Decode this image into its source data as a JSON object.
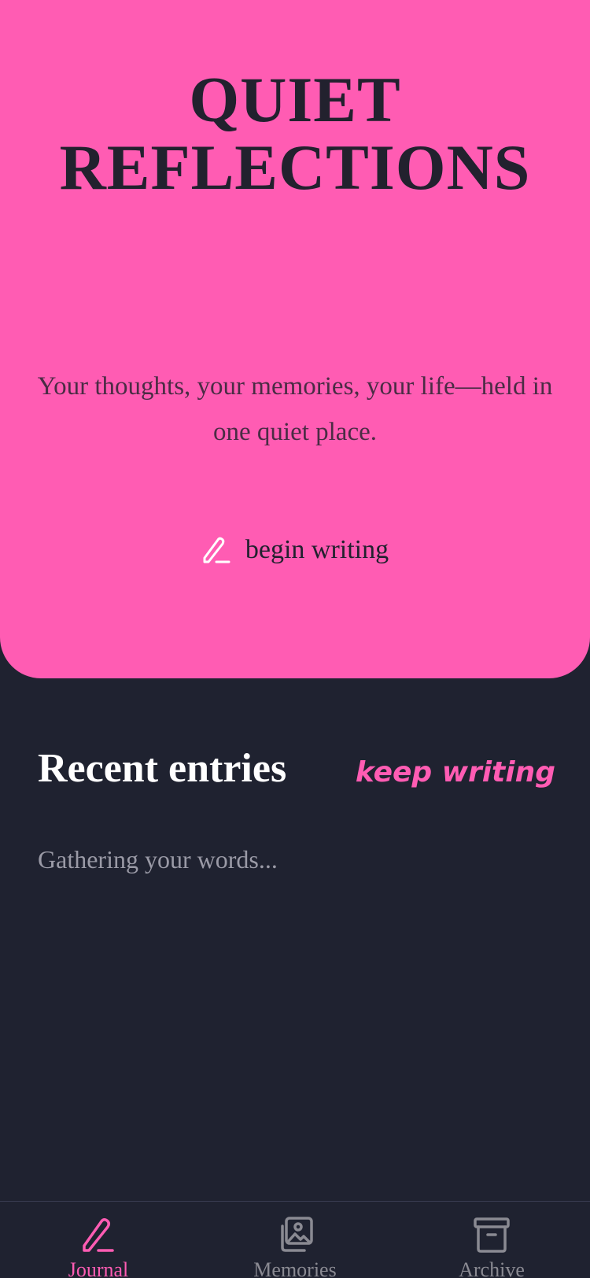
{
  "hero": {
    "title_line1": "QUIET",
    "title_line2": "REFLECTIONS",
    "subtitle": "Your thoughts, your memories, your life—held in one quiet place.",
    "cta_label": "begin writing",
    "cta_icon": "pencil-icon"
  },
  "recent": {
    "title": "Recent entries",
    "link_label": "keep writing",
    "loading_text": "Gathering your words..."
  },
  "nav": {
    "items": [
      {
        "label": "Journal",
        "icon": "pencil-icon",
        "active": true
      },
      {
        "label": "Memories",
        "icon": "photos-icon",
        "active": false
      },
      {
        "label": "Archive",
        "icon": "archive-icon",
        "active": false
      }
    ]
  },
  "colors": {
    "accent": "#ff5cb3",
    "background": "#1f2230",
    "text_dark": "#22212e",
    "muted": "#8a8a92"
  }
}
